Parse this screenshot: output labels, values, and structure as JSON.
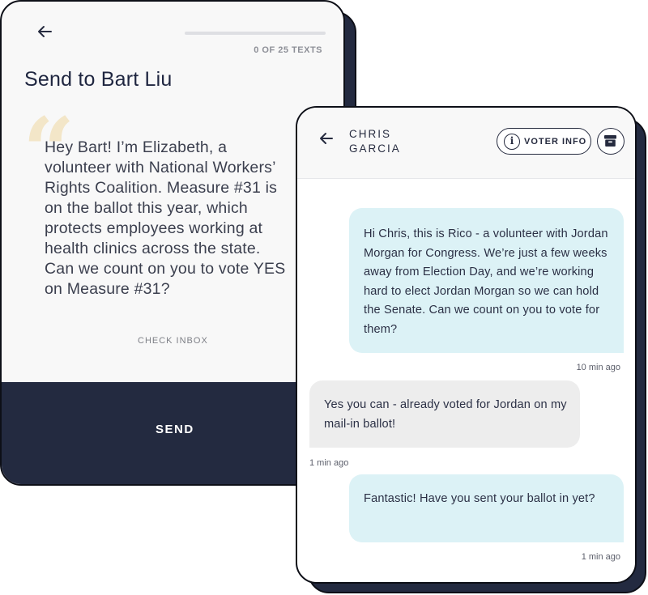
{
  "send_card": {
    "progress_fraction": 0,
    "progress_label": "0 OF 25 TEXTS",
    "title": "Send to Bart Liu",
    "quote_mark": "“",
    "message": "Hey Bart! I’m Elizabeth, a volunteer with National Workers’ Rights Coalition. Measure #31 is on the ballot this year, which protects employees working at health clinics across the state. Can we count on you to vote YES on Measure #31?",
    "check_inbox_label": "CHECK INBOX",
    "send_label": "SEND"
  },
  "conversation": {
    "contact_name": "CHRIS GARCIA",
    "voter_info_label": "VOTER INFO",
    "info_icon_glyph": "i",
    "messages": [
      {
        "direction": "outgoing",
        "text": "Hi Chris, this is Rico - a volunteer with Jordan Morgan for Congress. We’re just a few weeks away from Election Day, and we’re working hard to elect Jordan Morgan so we can hold the Senate. Can we count on you to vote for them?",
        "time": "10 min ago"
      },
      {
        "direction": "incoming",
        "text": "Yes you can - already voted for Jordan on my mail-in ballot!",
        "time": "1 min ago"
      },
      {
        "direction": "outgoing",
        "text": "Fantastic! Have you sent your ballot in yet?",
        "time": "1 min ago"
      }
    ]
  },
  "icons": {
    "back": "arrow-left-icon",
    "info": "info-icon",
    "archive": "archive-icon"
  },
  "colors": {
    "navy": "#232a40",
    "outgoing_bubble": "#dcf2f6",
    "incoming_bubble": "#ededed",
    "quote_mark": "#f3e6c8",
    "card_background": "#f8f8f8"
  }
}
